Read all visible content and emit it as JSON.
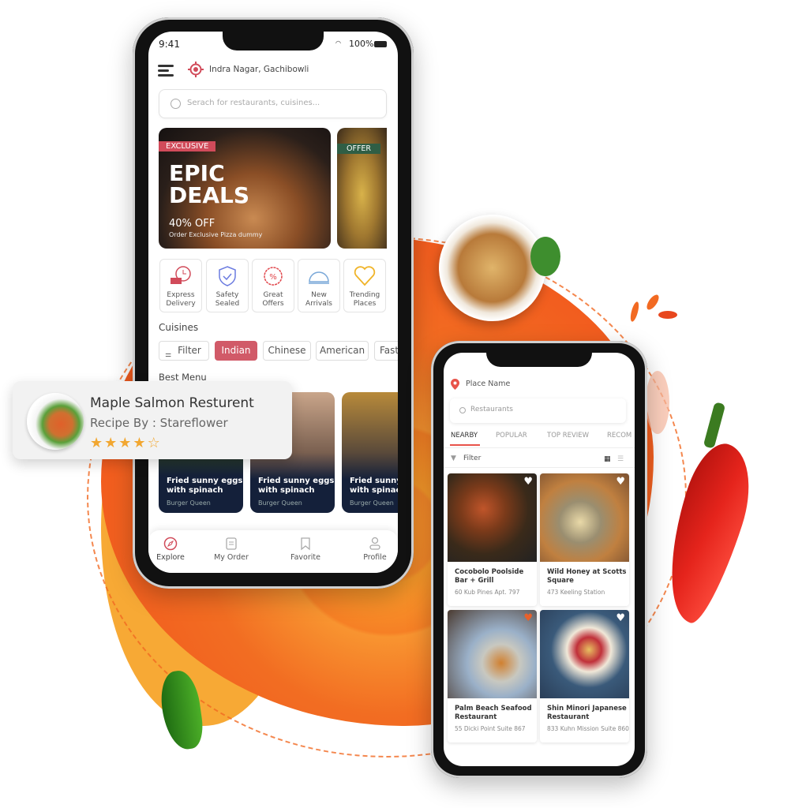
{
  "colors": {
    "accent": "#d14b5a",
    "orange": "#f26a22",
    "offer_green": "#2f5e45"
  },
  "main_phone": {
    "status": {
      "time": "9:41",
      "battery": "100%"
    },
    "location": "Indra Nagar, Gachibowli",
    "search": {
      "placeholder": "Serach for restaurants, cuisines..."
    },
    "banners": [
      {
        "badge": "EXCLUSIVE",
        "title_line1": "EPIC",
        "title_line2": "DEALS",
        "discount": "40% OFF",
        "subtitle": "Order Exclusive Pizza dummy"
      },
      {
        "badge": "OFFER"
      }
    ],
    "features": [
      {
        "line1": "Express",
        "line2": "Delivery",
        "icon": "delivery-truck-clock-icon"
      },
      {
        "line1": "Safety",
        "line2": "Sealed",
        "icon": "shield-check-icon"
      },
      {
        "line1": "Great",
        "line2": "Offers",
        "icon": "percent-badge-icon"
      },
      {
        "line1": "New",
        "line2": "Arrivals",
        "icon": "cloche-icon"
      },
      {
        "line1": "Trending",
        "line2": "Places",
        "icon": "heart-icon"
      }
    ],
    "cuisines_title": "Cuisines",
    "chips": [
      "Filter",
      "Indian",
      "Chinese",
      "American",
      "Fast"
    ],
    "selected_chip": "Indian",
    "best_menu_title": "Best Menu",
    "menu_cards": [
      {
        "title1": "Fried sunny eggs",
        "title2": "with spinach",
        "sub": "Burger Queen"
      },
      {
        "title1": "Fried sunny eggs",
        "title2": "with spinach",
        "sub": "Burger Queen"
      },
      {
        "title1": "Fried sunny",
        "title2": "with spinach",
        "sub": "Burger Queen"
      }
    ],
    "nav": [
      "Explore",
      "My Order",
      "Favorite",
      "Profile"
    ],
    "active_nav": "Explore"
  },
  "floating_card": {
    "title": "Maple Salmon Resturent",
    "subtitle": "Recipe By : Stareflower",
    "rating": 4,
    "rating_max": 5
  },
  "second_phone": {
    "place": "Place Name",
    "search": {
      "placeholder": "Restaurants"
    },
    "tabs": [
      "NEARBY",
      "POPULAR",
      "TOP REVIEW",
      "RECOM"
    ],
    "active_tab": "NEARBY",
    "filter": "Filter",
    "view_mode": "grid",
    "restaurants": [
      {
        "name": "Cocobolo Poolside Bar + Grill",
        "address": "60 Kub Pines Apt. 797",
        "favorite": false
      },
      {
        "name": "Wild Honey at Scotts Square",
        "address": "473 Keeling Station",
        "favorite": false
      },
      {
        "name": "Palm Beach Seafood Restaurant",
        "address": "55 Dicki Point Suite 867",
        "favorite": true
      },
      {
        "name": "Shin Minori Japanese Restaurant",
        "address": "833 Kuhn Mission Suite 860",
        "favorite": false
      }
    ]
  }
}
